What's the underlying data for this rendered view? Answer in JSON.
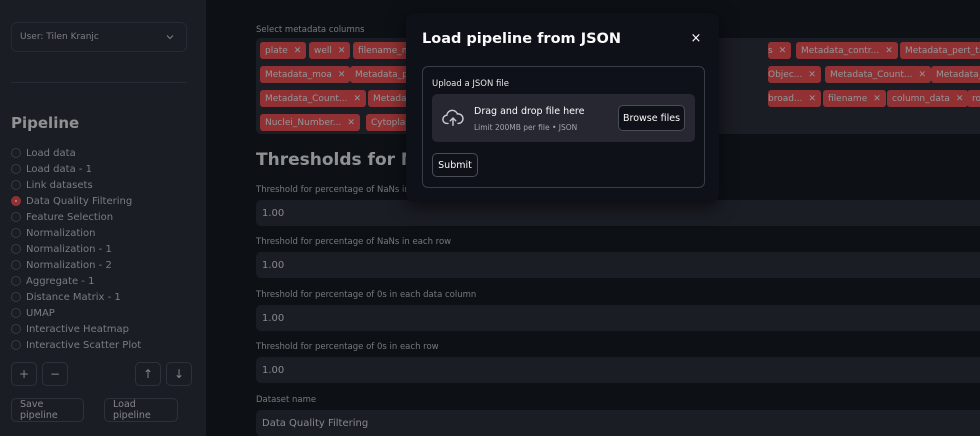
{
  "sidebar": {
    "user_select": "User: Tilen Kranjc",
    "pipeline_title": "Pipeline",
    "steps": [
      {
        "label": "Load data",
        "selected": false
      },
      {
        "label": "Load data - 1",
        "selected": false
      },
      {
        "label": "Link datasets",
        "selected": false
      },
      {
        "label": "Data Quality Filtering",
        "selected": true
      },
      {
        "label": "Feature Selection",
        "selected": false
      },
      {
        "label": "Normalization",
        "selected": false
      },
      {
        "label": "Normalization - 1",
        "selected": false
      },
      {
        "label": "Normalization - 2",
        "selected": false
      },
      {
        "label": "Aggregate - 1",
        "selected": false
      },
      {
        "label": "Distance Matrix - 1",
        "selected": false
      },
      {
        "label": "UMAP",
        "selected": false
      },
      {
        "label": "Interactive Heatmap",
        "selected": false
      },
      {
        "label": "Interactive Scatter Plot",
        "selected": false
      }
    ],
    "add_label": "+",
    "remove_label": "−",
    "up_label": "↑",
    "down_label": "↓",
    "save_label": "Save pipeline",
    "load_label": "Load pipeline"
  },
  "main": {
    "metadata_label": "Select metadata columns",
    "tags": [
      "plate",
      "well",
      "filename_m",
      "s",
      "Metadata_contr...",
      "Metadata_pert_t...",
      "Metadata_moa",
      "Metadata_p",
      "Objec...",
      "Metadata_Count...",
      "Metadata_Count...",
      "Metadata_Count...",
      "Metadata",
      "broad...",
      "filename",
      "column_data",
      "row_data",
      "Nuclei_Number...",
      "Cytopla"
    ],
    "section_title": "Thresholds for NaNs",
    "fields": [
      {
        "label": "Threshold for percentage of NaNs in each",
        "value": "1.00"
      },
      {
        "label": "Threshold for percentage of NaNs in each row",
        "value": "1.00"
      },
      {
        "label": "Threshold for percentage of 0s in each data column",
        "value": "1.00"
      },
      {
        "label": "Threshold for percentage of 0s in each row",
        "value": "1.00"
      },
      {
        "label": "Dataset name",
        "value": "Data Quality Filtering"
      }
    ]
  },
  "modal": {
    "title": "Load pipeline from JSON",
    "close_label": "×",
    "upload_label": "Upload a JSON file",
    "drop_text": "Drag and drop file here",
    "limit_text": "Limit 200MB per file • JSON",
    "browse_label": "Browse files",
    "submit_label": "Submit"
  },
  "colors": {
    "accent": "#ff4b4b",
    "background": "#0e1117",
    "sidebar": "#262730"
  }
}
